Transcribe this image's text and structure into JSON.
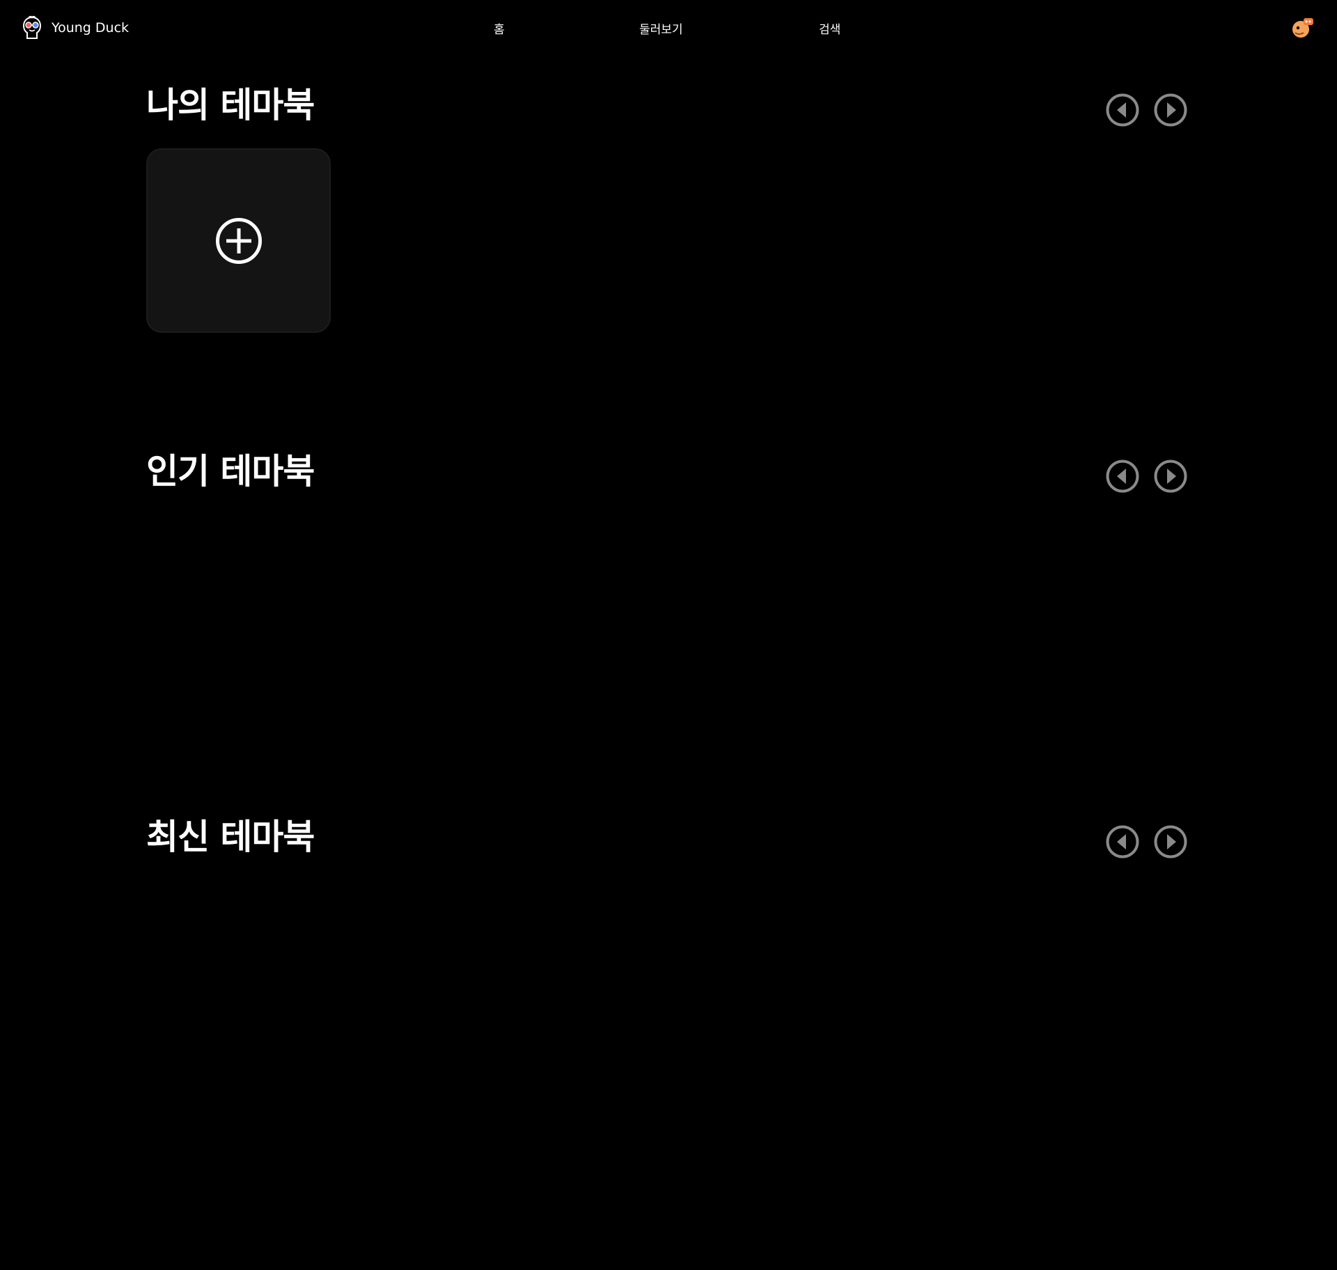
{
  "header": {
    "brand_name": "Young Duck",
    "logo_icon": "duck-with-glasses-icon",
    "nav": {
      "home": "홈",
      "browse": "둘러보기",
      "search": "검색"
    },
    "avatar_icon": "duck-avatar-icon"
  },
  "sections": {
    "my": {
      "title": "나의 테마북",
      "add_icon": "plus-circle-icon"
    },
    "popular": {
      "title": "인기 테마북"
    },
    "latest": {
      "title": "최신 테마북"
    }
  },
  "colors": {
    "background": "#000000",
    "text": "#ffffff",
    "card_background": "#141414",
    "arrow_button": "#8a8a8a",
    "avatar_orange": "#f5a35c"
  }
}
